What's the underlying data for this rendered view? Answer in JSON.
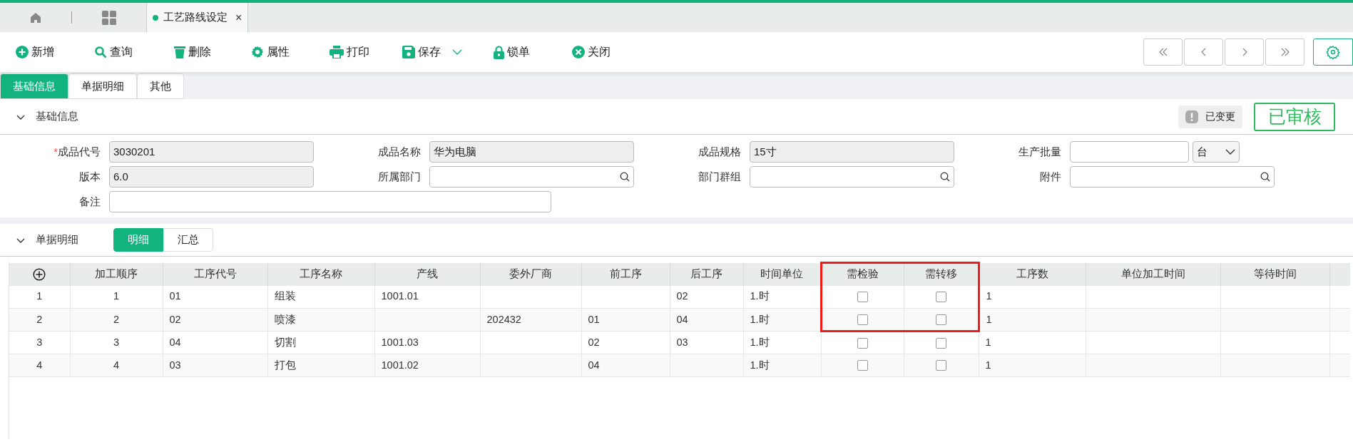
{
  "top_tabs": [
    {
      "kind": "home"
    },
    {
      "kind": "apps"
    },
    {
      "kind": "document",
      "label": "工艺路线设定",
      "close": "×",
      "selected": true
    }
  ],
  "toolbar": [
    {
      "kind": "add",
      "label": "新增"
    },
    {
      "kind": "search",
      "label": "查询"
    },
    {
      "kind": "delete",
      "label": "删除"
    },
    {
      "kind": "properties",
      "label": "属性"
    },
    {
      "kind": "print",
      "label": "打印"
    },
    {
      "kind": "save",
      "label": "保存",
      "has_menu": true
    },
    {
      "kind": "lock",
      "label": "锁单"
    },
    {
      "kind": "close",
      "label": "关闭"
    }
  ],
  "sub_tabs": [
    {
      "label": "基础信息",
      "selected": true
    },
    {
      "label": "单据明细",
      "selected": false
    },
    {
      "label": "其他",
      "selected": false
    }
  ],
  "basic_section": {
    "title": "基础信息",
    "expanded": true,
    "changed_badge": "已变更",
    "status_stamp": "已审核"
  },
  "form_rows": [
    [
      {
        "label": "成品代号",
        "required_mark": "*",
        "kind": "readonly",
        "value": "3030201"
      },
      {
        "label": "成品名称",
        "kind": "readonly",
        "value": "华为电脑"
      },
      {
        "label": "成品规格",
        "kind": "readonly",
        "value": "15寸"
      },
      {
        "label": "生产批量",
        "kind": "quantity",
        "unit": "台"
      }
    ],
    [
      {
        "label": "版本",
        "kind": "readonly",
        "value": "6.0"
      },
      {
        "label": "所属部门",
        "kind": "lookup"
      },
      {
        "label": "部门群组",
        "kind": "lookup"
      },
      {
        "label": "附件",
        "kind": "lookup"
      }
    ],
    [
      {
        "label": "备注",
        "kind": "wide"
      }
    ]
  ],
  "detail_section": {
    "title": "单据明细",
    "expanded": true,
    "views": [
      {
        "label": "明细",
        "selected": true
      },
      {
        "label": "汇总",
        "selected": false
      }
    ]
  },
  "table": {
    "columns": [
      {
        "label": "加工顺序",
        "kind": "center",
        "highlighted": false
      },
      {
        "label": "工序代号",
        "kind": "text",
        "highlighted": false
      },
      {
        "label": "工序名称",
        "kind": "text",
        "highlighted": false
      },
      {
        "label": "产线",
        "kind": "text",
        "highlighted": false
      },
      {
        "label": "委外厂商",
        "kind": "text",
        "highlighted": false
      },
      {
        "label": "前工序",
        "kind": "text",
        "highlighted": false
      },
      {
        "label": "后工序",
        "kind": "text",
        "highlighted": false
      },
      {
        "label": "时间单位",
        "kind": "text",
        "highlighted": false
      },
      {
        "label": "需检验",
        "kind": "check",
        "highlighted": true
      },
      {
        "label": "需转移",
        "kind": "check",
        "highlighted": true
      },
      {
        "label": "工序数",
        "kind": "text",
        "highlighted": false
      },
      {
        "label": "单位加工时间",
        "kind": "text",
        "highlighted": false
      },
      {
        "label": "等待时间",
        "kind": "text",
        "highlighted": false
      }
    ],
    "rows": [
      {
        "index": "1",
        "highlighted": true,
        "cells": [
          "1",
          "01",
          "组装",
          "1001.01",
          null,
          null,
          "02",
          "1.时",
          false,
          false,
          "1",
          null,
          null
        ]
      },
      {
        "index": "2",
        "highlighted": true,
        "cells": [
          "2",
          "02",
          "喷漆",
          null,
          "202432",
          "01",
          "04",
          "1.时",
          false,
          false,
          "1",
          null,
          null
        ]
      },
      {
        "index": "3",
        "highlighted": false,
        "cells": [
          "3",
          "04",
          "切割",
          "1001.03",
          null,
          "02",
          "03",
          "1.时",
          false,
          false,
          "1",
          null,
          null
        ]
      },
      {
        "index": "4",
        "highlighted": false,
        "cells": [
          "4",
          "03",
          "打包",
          "1001.02",
          null,
          "04",
          null,
          "1.时",
          false,
          false,
          "1",
          null,
          null
        ]
      }
    ]
  }
}
